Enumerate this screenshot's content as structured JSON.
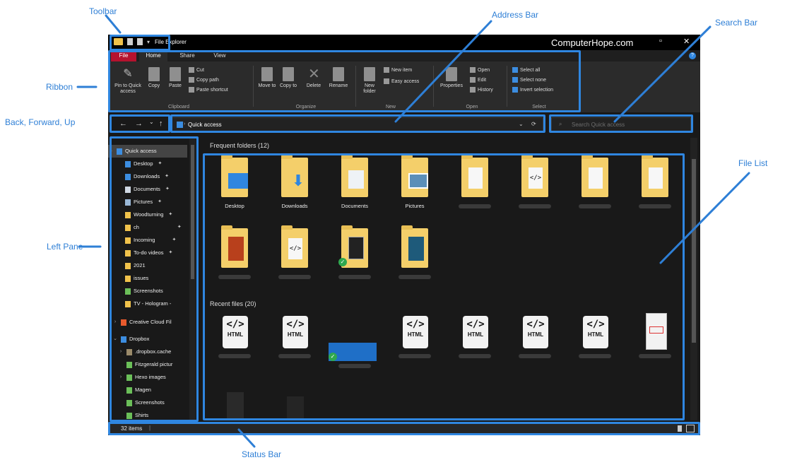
{
  "callouts": {
    "toolbar": "Toolbar",
    "address_bar": "Address Bar",
    "search_bar": "Search Bar",
    "ribbon": "Ribbon",
    "back_forward_up": "Back, Forward, Up",
    "file_list": "File List",
    "left_pane": "Left Pane",
    "status_bar": "Status Bar"
  },
  "window": {
    "title": "File Explorer",
    "brand": "ComputerHope.com",
    "minimize_icon": "minimize-icon",
    "close_icon": "close-icon"
  },
  "tabs": {
    "file": "File",
    "home": "Home",
    "share": "Share",
    "view": "View"
  },
  "ribbon": {
    "pin": "Pin to Quick access",
    "copy": "Copy",
    "paste": "Paste",
    "cut": "Cut",
    "copy_path": "Copy path",
    "paste_shortcut": "Paste shortcut",
    "move_to": "Move to",
    "copy_to": "Copy to",
    "delete": "Delete",
    "rename": "Rename",
    "new_folder": "New folder",
    "new_item": "New item",
    "easy_access": "Easy access",
    "properties": "Properties",
    "open": "Open",
    "edit": "Edit",
    "history": "History",
    "select_all": "Select all",
    "select_none": "Select none",
    "invert_selection": "Invert selection",
    "groups": {
      "clipboard": "Clipboard",
      "organize": "Organize",
      "new": "New",
      "open": "Open",
      "select": "Select"
    }
  },
  "nav": {
    "back": "←",
    "forward": "→",
    "recent": "⌄",
    "up": "↑"
  },
  "address": {
    "path": "Quick access",
    "refresh": "⟳",
    "dropdown": "⌄"
  },
  "search": {
    "placeholder": "Search Quick access"
  },
  "left_pane": {
    "quick_access": "Quick access",
    "quick_items": [
      "Desktop",
      "Downloads",
      "Documents",
      "Pictures",
      "Woodturning",
      "ch",
      "Incoming",
      "To-do videos",
      "2021",
      "issues",
      "Screenshots",
      "TV - Hologram -"
    ],
    "creative_cloud": "Creative Cloud Fil",
    "dropbox": "Dropbox",
    "dropbox_items": [
      ".dropbox.cache",
      "Fitzgerald pictur",
      "Hexo images",
      "Magen",
      "Screenshots",
      "Shirts"
    ]
  },
  "content": {
    "frequent_header": "Frequent folders (12)",
    "recent_header": "Recent files (20)",
    "frequent_names": [
      "Desktop",
      "Downloads",
      "Documents",
      "Pictures"
    ],
    "html_tag": "</>",
    "html_label": "HTML"
  },
  "status": {
    "items": "32 items"
  },
  "colors": {
    "highlight": "#2f86e0",
    "callout": "#2e7fd6",
    "folder": "#f4cf6a",
    "file_tab": "#b5122e"
  }
}
